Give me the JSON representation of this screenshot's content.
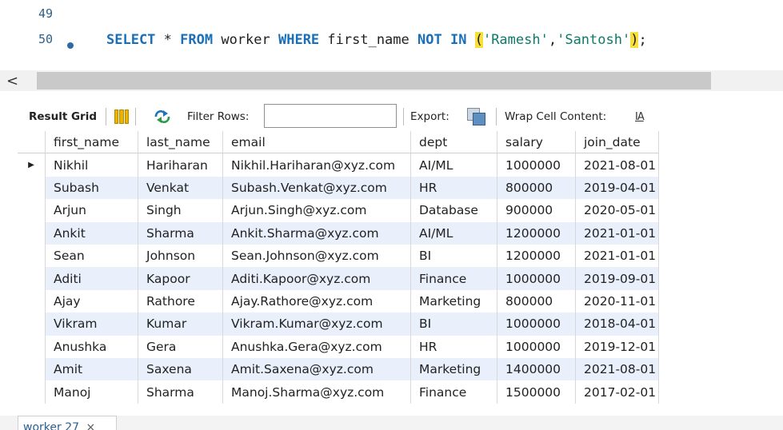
{
  "editor": {
    "lines": [
      {
        "number": "49",
        "code": ""
      },
      {
        "number": "50",
        "code": "SELECT * FROM worker WHERE first_name NOT IN ('Ramesh','Santosh');"
      }
    ],
    "tokens": {
      "select": "SELECT",
      "star": " * ",
      "from": "FROM",
      "table": " worker ",
      "where": "WHERE",
      "col": " first_name ",
      "not": "NOT",
      "sp": " ",
      "in": "IN",
      "sp2": " ",
      "lparen": "(",
      "s1": "'Ramesh'",
      "comma": ",",
      "s2": "'Santosh'",
      "rparen": ")",
      "semi": ";"
    }
  },
  "scrollbar": {
    "left_arrow": "<"
  },
  "toolbar": {
    "result_grid_label": "Result Grid",
    "filter_rows_label": "Filter Rows:",
    "filter_rows_value": "",
    "export_label": "Export:",
    "wrap_label": "Wrap Cell Content:",
    "wrap_icon_text": "IA",
    "filter_icon": "refresh-arrows-icon",
    "grid_icon": "grid-columns-icon",
    "export_icon": "export-file-icon"
  },
  "grid": {
    "columns": [
      "first_name",
      "last_name",
      "email",
      "dept",
      "salary",
      "join_date"
    ],
    "current_row_marker": "▶",
    "rows": [
      [
        "Nikhil",
        "Hariharan",
        "Nikhil.Hariharan@xyz.com",
        "AI/ML",
        "1000000",
        "2021-08-01"
      ],
      [
        "Subash",
        "Venkat",
        "Subash.Venkat@xyz.com",
        "HR",
        "800000",
        "2019-04-01"
      ],
      [
        "Arjun",
        "Singh",
        "Arjun.Singh@xyz.com",
        "Database",
        "900000",
        "2020-05-01"
      ],
      [
        "Ankit",
        "Sharma",
        "Ankit.Sharma@xyz.com",
        "AI/ML",
        "1200000",
        "2021-01-01"
      ],
      [
        "Sean",
        "Johnson",
        "Sean.Johnson@xyz.com",
        "BI",
        "1200000",
        "2021-01-01"
      ],
      [
        "Aditi",
        "Kapoor",
        "Aditi.Kapoor@xyz.com",
        "Finance",
        "1000000",
        "2019-09-01"
      ],
      [
        "Ajay",
        "Rathore",
        "Ajay.Rathore@xyz.com",
        "Marketing",
        "800000",
        "2020-11-01"
      ],
      [
        "Vikram",
        "Kumar",
        "Vikram.Kumar@xyz.com",
        "BI",
        "1000000",
        "2018-04-01"
      ],
      [
        "Anushka",
        "Gera",
        "Anushka.Gera@xyz.com",
        "HR",
        "1000000",
        "2019-12-01"
      ],
      [
        "Amit",
        "Saxena",
        "Amit.Saxena@xyz.com",
        "Marketing",
        "1400000",
        "2021-08-01"
      ],
      [
        "Manoj",
        "Sharma",
        "Manoj.Sharma@xyz.com",
        "Finance",
        "1500000",
        "2017-02-01"
      ]
    ]
  },
  "tabs": [
    {
      "label": "worker 27",
      "close": "×"
    }
  ],
  "colors": {
    "keyword": "#1a6fb8",
    "string": "#0e7a6b",
    "paren_highlight": "#f7e03c",
    "row_alt": "#e9f0fb",
    "line_number": "#2e5f8a"
  }
}
